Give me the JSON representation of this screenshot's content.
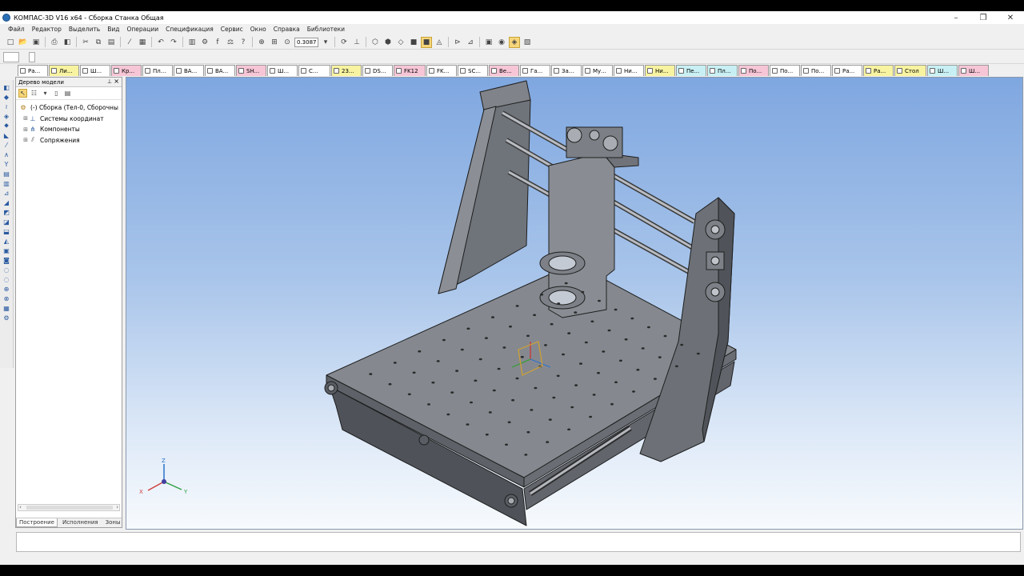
{
  "window": {
    "title": "КОМПАС-3D V16  x64 - Сборка Станка Общая",
    "controls": [
      "–",
      "❐",
      "✕"
    ]
  },
  "menu": [
    "Файл",
    "Редактор",
    "Выделить",
    "Вид",
    "Операции",
    "Спецификация",
    "Сервис",
    "Окно",
    "Справка",
    "Библиотеки"
  ],
  "toolbar": {
    "zoom_value": "0.3087"
  },
  "tabs": [
    {
      "label": "Ра...",
      "color": "#ffffff"
    },
    {
      "label": "Ли...",
      "color": "#f7f3a0"
    },
    {
      "label": "Ш...",
      "color": "#ffffff"
    },
    {
      "label": "Кр...",
      "color": "#f7c6d6"
    },
    {
      "label": "Пл...",
      "color": "#ffffff"
    },
    {
      "label": "ВА...",
      "color": "#ffffff"
    },
    {
      "label": "ВА...",
      "color": "#ffffff"
    },
    {
      "label": "SH...",
      "color": "#f7c6d6"
    },
    {
      "label": "Ш...",
      "color": "#ffffff"
    },
    {
      "label": "С...",
      "color": "#ffffff"
    },
    {
      "label": "23...",
      "color": "#f7f3a0"
    },
    {
      "label": "DS...",
      "color": "#ffffff"
    },
    {
      "label": "FK12",
      "color": "#f7c6d6"
    },
    {
      "label": "FK...",
      "color": "#ffffff"
    },
    {
      "label": "SC...",
      "color": "#ffffff"
    },
    {
      "label": "Ве...",
      "color": "#f7c6d6"
    },
    {
      "label": "Га...",
      "color": "#ffffff"
    },
    {
      "label": "За...",
      "color": "#ffffff"
    },
    {
      "label": "Му...",
      "color": "#ffffff"
    },
    {
      "label": "Ни...",
      "color": "#ffffff"
    },
    {
      "label": "Ни...",
      "color": "#f7f3a0"
    },
    {
      "label": "Пе...",
      "color": "#c8f0f4"
    },
    {
      "label": "Пл...",
      "color": "#c8f0f4"
    },
    {
      "label": "По...",
      "color": "#f7c6d6"
    },
    {
      "label": "По...",
      "color": "#ffffff"
    },
    {
      "label": "По...",
      "color": "#ffffff"
    },
    {
      "label": "Ра...",
      "color": "#ffffff"
    },
    {
      "label": "Ра...",
      "color": "#f7f3a0"
    },
    {
      "label": "Стол",
      "color": "#f7f3a0"
    },
    {
      "label": "Ш...",
      "color": "#c8f0f4"
    },
    {
      "label": "Ш...",
      "color": "#f7c6d6"
    }
  ],
  "model_tree": {
    "title": "Дерево модели",
    "nodes": [
      {
        "label": "(-) Сборка (Тел-0, Сборочны",
        "icon": "assembly-icon",
        "level": 0
      },
      {
        "label": "Системы координат",
        "icon": "coordinate-systems-icon",
        "level": 1
      },
      {
        "label": "Компоненты",
        "icon": "components-icon",
        "level": 1
      },
      {
        "label": "Сопряжения",
        "icon": "mates-icon",
        "level": 1
      }
    ],
    "bottom_tabs": [
      "Построение",
      "Исполнения",
      "Зоны"
    ]
  },
  "viewport": {
    "axis_labels": {
      "x": "X",
      "y": "Y",
      "z": "Z"
    },
    "background_top": "#7fa7e0",
    "background_bottom": "#f7fafd",
    "model_color": "#7b7f86"
  }
}
